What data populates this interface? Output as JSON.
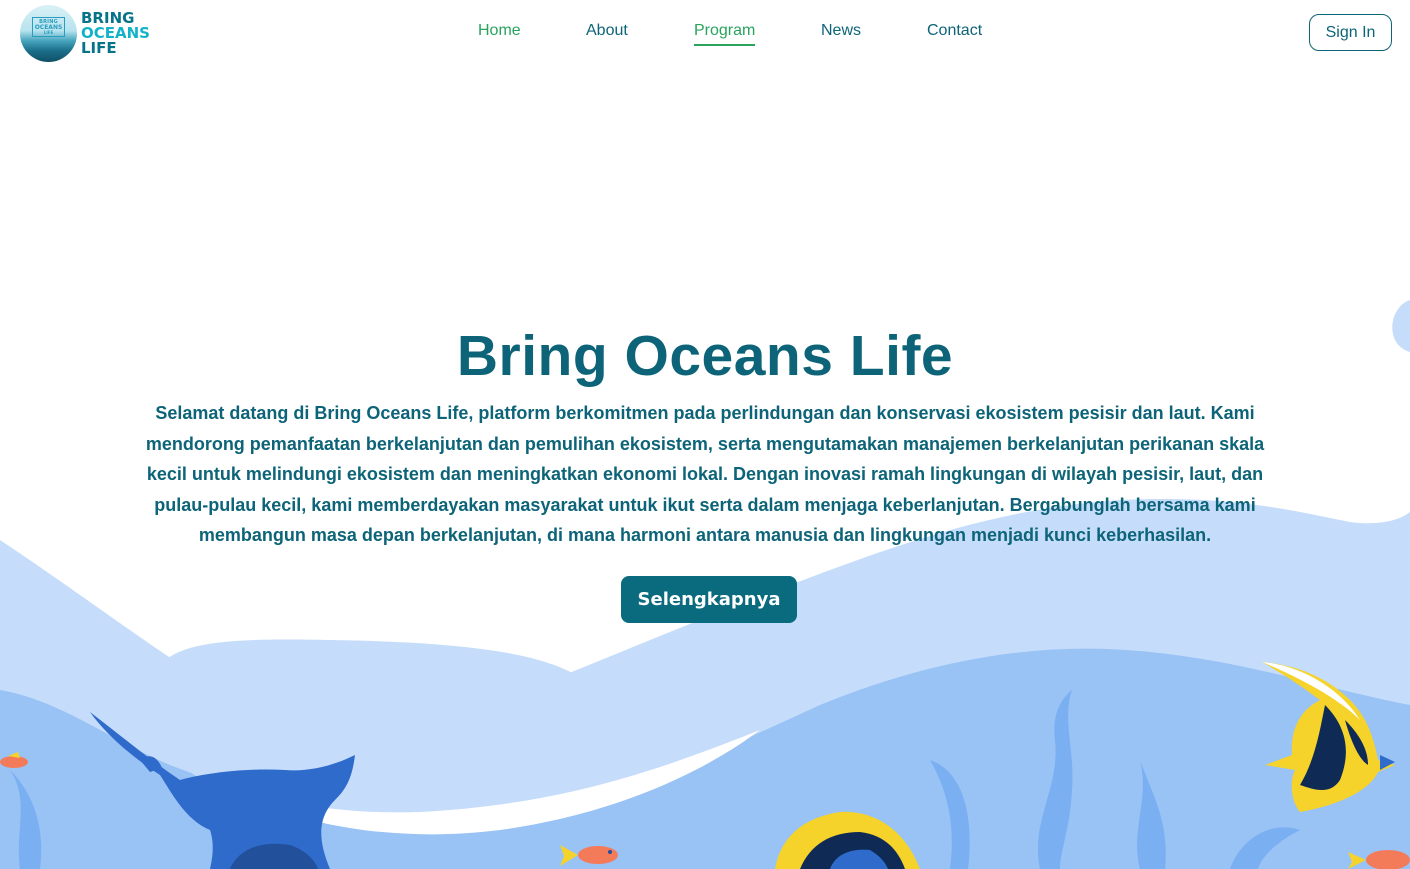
{
  "brand": {
    "badge_line1": "BRING",
    "badge_line2": "OCEANS",
    "badge_line3": "LIFE",
    "name_line1": "BRING",
    "name_line2": "OCEANS",
    "name_line3": "LIFE"
  },
  "nav": {
    "items": [
      {
        "label": "Home"
      },
      {
        "label": "About"
      },
      {
        "label": "Program"
      },
      {
        "label": "News"
      },
      {
        "label": "Contact"
      }
    ],
    "active": "Program"
  },
  "header": {
    "signin_label": "Sign In"
  },
  "hero": {
    "title": "Bring Oceans Life",
    "description": "Selamat datang di Bring Oceans Life, platform berkomitmen pada perlindungan dan konservasi ekosistem pesisir dan laut. Kami mendorong pemanfaatan berkelanjutan dan pemulihan ekosistem, serta mengutamakan manajemen berkelanjutan perikanan skala kecil untuk melindungi ekosistem dan meningkatkan ekonomi lokal. Dengan inovasi ramah lingkungan di wilayah pesisir, laut, dan pulau-pulau kecil, kami memberdayakan masyarakat untuk ikut serta dalam menjaga keberlanjutan. Bergabunglah bersama kami membangun masa depan berkelanjutan, di mana harmoni antara manusia dan lingkungan menjadi kunci keberhasilan.",
    "button_label": "Selengkapnya"
  },
  "colors": {
    "primary": "#0d6478",
    "accent_green": "#29a35d",
    "button_bg": "#0a6b7e",
    "wave_light": "#c5ddfb",
    "wave_mid": "#99c2f5",
    "wave_deep": "#2f6bcb",
    "fish_yellow": "#f5d32a",
    "fish_orange": "#f47b5a"
  },
  "icons": [
    "logo-badge",
    "manta-ray-icon",
    "angelfish-icon",
    "small-fish-icon",
    "seaweed-icon"
  ]
}
